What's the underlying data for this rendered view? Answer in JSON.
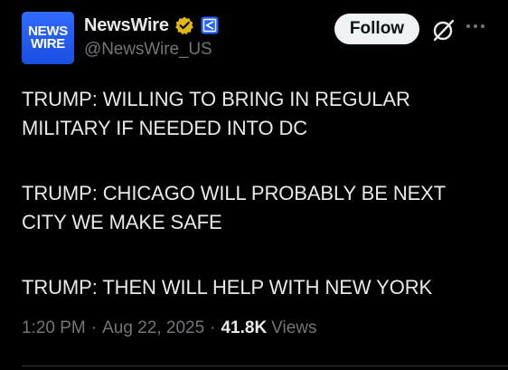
{
  "account": {
    "avatar_line1": "NEWS",
    "avatar_line2": "WIRE",
    "display_name": "NewsWire",
    "handle": "@NewsWire_US",
    "verified_badge_icon": "gold-check-icon",
    "affiliate_icon": "newswire-affiliate-icon"
  },
  "actions": {
    "follow_label": "Follow",
    "grok_icon": "grok-icon",
    "more_icon": "more-dots-icon"
  },
  "post": {
    "paragraphs": [
      "TRUMP: WILLING TO BRING IN REGULAR\nMILITARY IF NEEDED INTO DC",
      "TRUMP: CHICAGO WILL PROBABLY BE NEXT\nCITY WE MAKE SAFE",
      "TRUMP: THEN WILL HELP WITH NEW YORK"
    ]
  },
  "meta": {
    "time": "1:20 PM",
    "separator": "·",
    "date": "Aug 22, 2025",
    "views_count": "41.8K",
    "views_label": "Views"
  },
  "colors": {
    "background": "#000000",
    "text_primary": "#e7e9ea",
    "text_secondary": "#71767b",
    "avatar_blue": "#2563ff",
    "verified_gold": "#e2b719",
    "follow_bg": "#eff3f4"
  }
}
